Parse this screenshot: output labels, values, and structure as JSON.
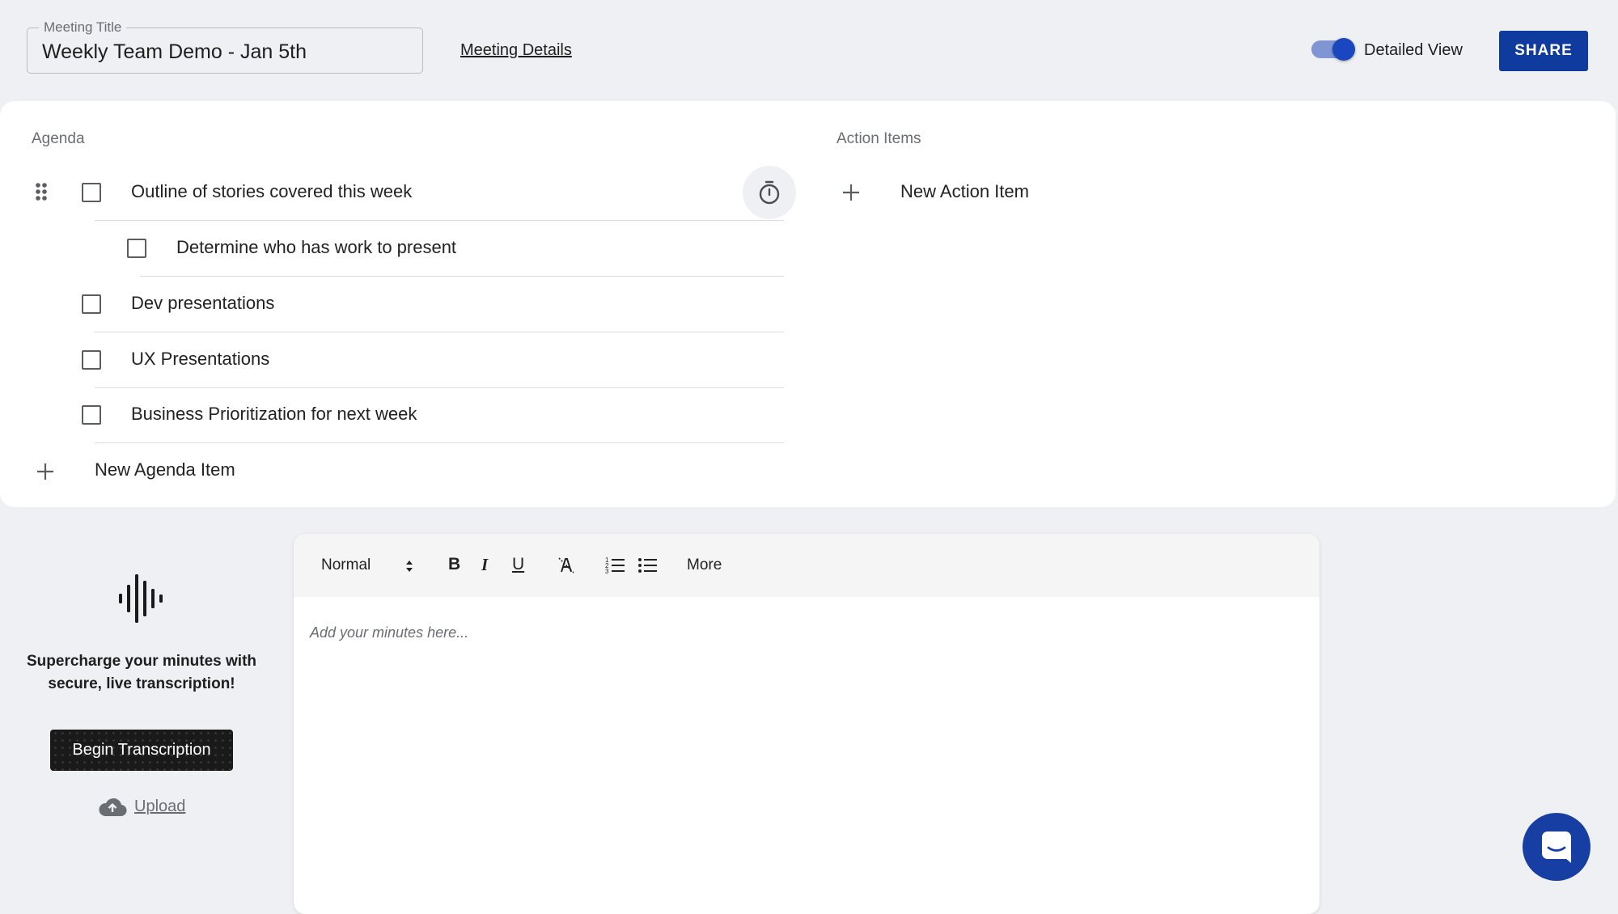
{
  "header": {
    "title_legend": "Meeting Title",
    "title_value": "Weekly Team Demo - Jan 5th",
    "meeting_details_link": "Meeting Details",
    "toggle_label": "Detailed View",
    "toggle_on": true,
    "share_label": "SHARE"
  },
  "agenda": {
    "label": "Agenda",
    "items": [
      {
        "text": "Outline of stories covered this week",
        "checked": false,
        "indent": 0
      },
      {
        "text": "Determine who has work to present",
        "checked": false,
        "indent": 1
      },
      {
        "text": "Dev presentations",
        "checked": false,
        "indent": 0
      },
      {
        "text": "UX Presentations",
        "checked": false,
        "indent": 0
      },
      {
        "text": "Business Prioritization for next week",
        "checked": false,
        "indent": 0
      }
    ],
    "new_item_label": "New Agenda Item"
  },
  "action_items": {
    "label": "Action Items",
    "new_item_label": "New Action Item"
  },
  "transcription": {
    "promo_line1": "Supercharge your minutes with",
    "promo_line2": "secure, live transcription!",
    "begin_button": "Begin Transcription",
    "upload_link": "Upload"
  },
  "editor": {
    "style_select": "Normal",
    "more_label": "More",
    "placeholder": "Add your minutes here..."
  },
  "colors": {
    "accent": "#0f3a9e",
    "toggle_track": "#7f95d4",
    "toggle_knob": "#1a47c0",
    "chat_button": "#163ea3",
    "page_background": "#eef0f3"
  },
  "icons": [
    "drag-handle-icon",
    "timer-icon",
    "plus-icon",
    "audio-wave-icon",
    "cloud-upload-icon",
    "bold-icon",
    "italic-icon",
    "underline-icon",
    "clear-format-icon",
    "ordered-list-icon",
    "bullet-list-icon",
    "chat-icon"
  ]
}
